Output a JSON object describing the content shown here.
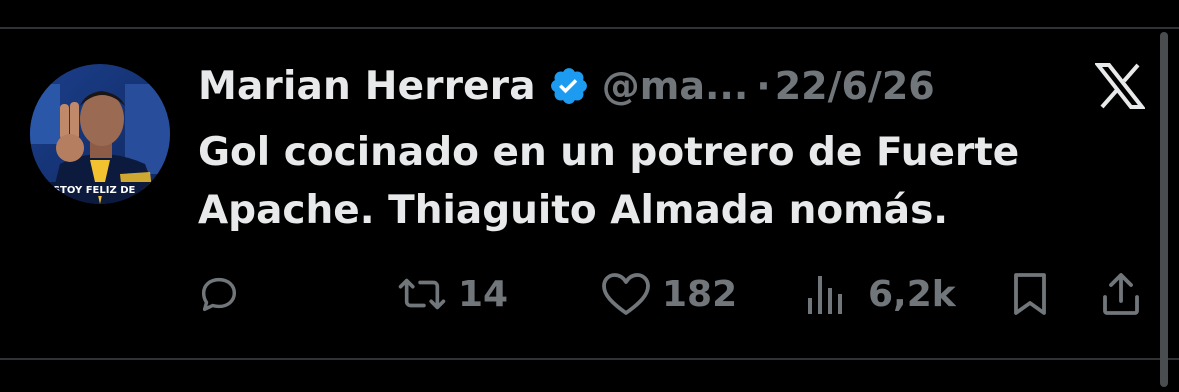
{
  "tweet": {
    "author_name": "Marian Herrera",
    "handle": "@ma...",
    "separator": "·",
    "date": "22/6/26",
    "text_line1": "Gol cocinado en un potrero de Fuerte",
    "text_line2": "Apache. Thiaguito Almada nomás.",
    "avatar_caption": "ESTOY FELIZ DE",
    "platform_icon": "x-logo-icon",
    "verified_icon": "verified-badge-icon"
  },
  "actions": {
    "reply": {
      "icon": "reply-icon",
      "count": ""
    },
    "retweet": {
      "icon": "retweet-icon",
      "count": "14"
    },
    "like": {
      "icon": "heart-icon",
      "count": "182"
    },
    "views": {
      "icon": "views-icon",
      "count": "6,2k"
    },
    "bookmark": {
      "icon": "bookmark-icon"
    },
    "share": {
      "icon": "share-icon"
    }
  },
  "colors": {
    "background": "#000000",
    "text_primary": "#e7e9ea",
    "text_secondary": "#71767b",
    "verified": "#1d9bf0",
    "divider": "#2f3336"
  }
}
